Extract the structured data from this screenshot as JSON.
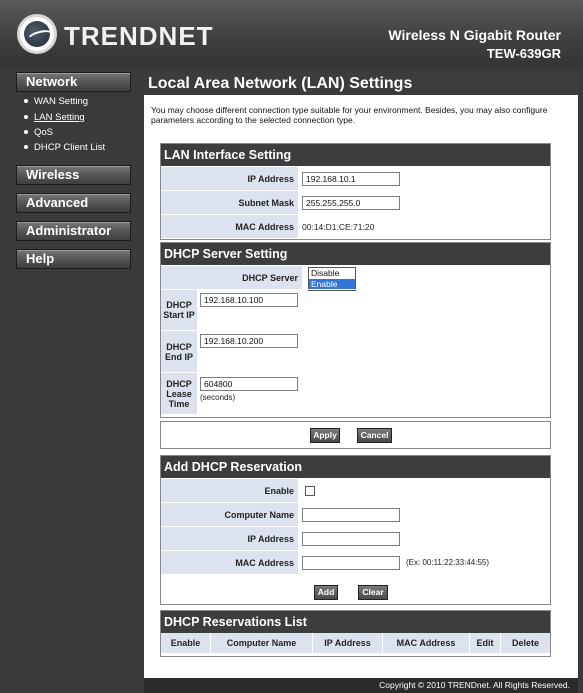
{
  "header": {
    "brand": "TRENDNET",
    "product": "Wireless N Gigabit Router",
    "model": "TEW-639GR"
  },
  "sidebar": {
    "sections": [
      {
        "label": "Network"
      },
      {
        "label": "Wireless"
      },
      {
        "label": "Advanced"
      },
      {
        "label": "Administrator"
      },
      {
        "label": "Help"
      }
    ],
    "network_items": [
      {
        "label": "WAN Setting"
      },
      {
        "label": "LAN Setting"
      },
      {
        "label": "QoS"
      },
      {
        "label": "DHCP Client List"
      }
    ]
  },
  "page": {
    "title": "Local Area Network (LAN) Settings",
    "intro": "You may choose different connection type suitable for your environment. Besides, you may also configure parameters according to the selected connection type."
  },
  "lan": {
    "title": "LAN Interface Setting",
    "ip_label": "IP Address",
    "ip_value": "192.168.10.1",
    "mask_label": "Subnet Mask",
    "mask_value": "255.255.255.0",
    "mac_label": "MAC Address",
    "mac_value": "00:14:D1:CE:71:20"
  },
  "dhcp": {
    "title": "DHCP Server Setting",
    "server_label": "DHCP Server",
    "options": [
      "Disable",
      "Enable"
    ],
    "selected": "Enable",
    "start_label": "DHCP Start IP",
    "start_value": "192.168.10.100",
    "end_label": "DHCP End IP",
    "end_value": "192.168.10.200",
    "lease_label": "DHCP Lease Time",
    "lease_value": "604800",
    "lease_unit": "(seconds)"
  },
  "actions": {
    "apply": "Apply",
    "cancel": "Cancel"
  },
  "reservation": {
    "title": "Add DHCP Reservation",
    "enable_label": "Enable",
    "name_label": "Computer Name",
    "ip_label": "IP Address",
    "mac_label": "MAC Address",
    "mac_example": "(Ex: 00:11:22:33:44:55)",
    "add": "Add",
    "clear": "Clear"
  },
  "reservations_list": {
    "title": "DHCP Reservations List",
    "columns": [
      "Enable",
      "Computer Name",
      "IP Address",
      "MAC Address",
      "Edit",
      "Delete"
    ]
  },
  "footer": {
    "copyright": "Copyright © 2010 TRENDnet. All Rights Reserved."
  }
}
